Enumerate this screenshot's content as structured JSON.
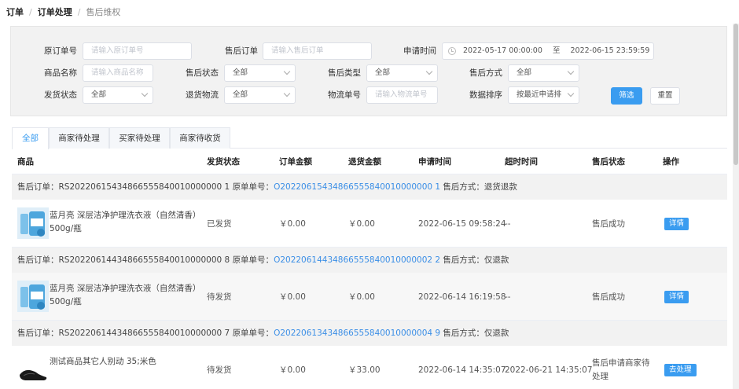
{
  "breadcrumb": [
    "订单",
    "订单处理",
    "售后维权"
  ],
  "filters": {
    "original_order": {
      "label": "原订单号",
      "placeholder": "请输入原订单号"
    },
    "aftersale_order": {
      "label": "售后订单",
      "placeholder": "请输入售后订单"
    },
    "apply_time": {
      "label": "申请时间",
      "start": "2022-05-17 00:00:00",
      "sep": "至",
      "end": "2022-06-15 23:59:59"
    },
    "product_name": {
      "label": "商品名称",
      "placeholder": "请输入商品名称"
    },
    "aftersale_status": {
      "label": "售后状态",
      "value": "全部"
    },
    "aftersale_type": {
      "label": "售后类型",
      "value": "全部"
    },
    "aftersale_method": {
      "label": "售后方式",
      "value": "全部"
    },
    "ship_status": {
      "label": "发货状态",
      "value": "全部"
    },
    "return_logistics": {
      "label": "退货物流",
      "value": "全部"
    },
    "tracking_no": {
      "label": "物流单号",
      "placeholder": "请输入物流单号"
    },
    "sort": {
      "label": "数据排序",
      "value": "按最近申请排"
    },
    "filter_button": "筛选",
    "reset_button": "重置"
  },
  "tabs": [
    "全部",
    "商家待处理",
    "买家待处理",
    "商家待收货"
  ],
  "columns": [
    "商品",
    "发货状态",
    "订单金额",
    "退货金额",
    "申请时间",
    "超时时间",
    "售后状态",
    "操作"
  ],
  "groups": [
    {
      "aftersale_label": "售后订单：",
      "aftersale_no": "RS20220615434866555840010000000 1",
      "original_label": "原单单号：",
      "original_no": "O20220615434866555840010000000 1",
      "method_label": "售后方式：",
      "method": "退货退款",
      "product": "蓝月亮 深层洁净护理洗衣液（自然清香）500g/瓶",
      "ship_status": "已发货",
      "order_amount": "￥0.00",
      "refund_amount": "￥0.00",
      "apply_time": "2022-06-15 09:58:24",
      "timeout": "--",
      "status": "售后成功",
      "action": "详情",
      "thumb": "detergent"
    },
    {
      "aftersale_label": "售后订单：",
      "aftersale_no": "RS20220614434866555840010000000 8",
      "original_label": "原单单号：",
      "original_no": "O20220614434866555840010000002 2",
      "method_label": "售后方式：",
      "method": "仅退款",
      "product": "蓝月亮 深层洁净护理洗衣液（自然清香）500g/瓶",
      "ship_status": "待发货",
      "order_amount": "￥0.00",
      "refund_amount": "￥0.00",
      "apply_time": "2022-06-14 16:19:58",
      "timeout": "--",
      "status": "售后成功",
      "action": "详情",
      "thumb": "detergent"
    },
    {
      "aftersale_label": "售后订单：",
      "aftersale_no": "RS20220614434866555840010000000 7",
      "original_label": "原单单号：",
      "original_no": "O20220613434866555840010000004 9",
      "method_label": "售后方式：",
      "method": "仅退款",
      "product": "测试商品其它人别动 35;米色",
      "ship_status": "待发货",
      "order_amount": "￥0.00",
      "refund_amount": "￥33.00",
      "apply_time": "2022-06-14 14:35:07",
      "timeout": "2022-06-21 14:35:07",
      "status": "售后申请商家待处理",
      "action": "去处理",
      "thumb": "shoe"
    }
  ]
}
